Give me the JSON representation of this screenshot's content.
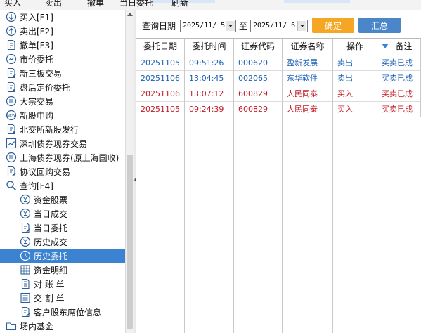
{
  "toolbar": {
    "items": [
      "买入",
      "卖出",
      "撤单",
      "当日委托",
      "刷新"
    ]
  },
  "sidebar": {
    "items": [
      {
        "label": "买入[F1]",
        "icon": "arrow-down-circle-icon",
        "sub": false,
        "selected": false
      },
      {
        "label": "卖出[F2]",
        "icon": "arrow-up-circle-icon",
        "sub": false,
        "selected": false
      },
      {
        "label": "撤单[F3]",
        "icon": "cancel-order-icon",
        "sub": false,
        "selected": false
      },
      {
        "label": "市价委托",
        "icon": "market-order-icon",
        "sub": false,
        "selected": false
      },
      {
        "label": "新三板交易",
        "icon": "document-edit-icon",
        "sub": false,
        "selected": false
      },
      {
        "label": "盘后定价委托",
        "icon": "document-edit-icon",
        "sub": false,
        "selected": false
      },
      {
        "label": "大宗交易",
        "icon": "list-circle-icon",
        "sub": false,
        "selected": false
      },
      {
        "label": "新股申购",
        "icon": "new-badge-icon",
        "sub": false,
        "selected": false
      },
      {
        "label": "北交所新股发行",
        "icon": "document-edit-icon",
        "sub": false,
        "selected": false
      },
      {
        "label": "深圳债券现券交易",
        "icon": "chart-icon",
        "sub": false,
        "selected": false
      },
      {
        "label": "上海债券现券(原上海国收)",
        "icon": "list-circle-icon",
        "sub": false,
        "selected": false
      },
      {
        "label": "协议回购交易",
        "icon": "document-edit-icon",
        "sub": false,
        "selected": false
      },
      {
        "label": "查询[F4]",
        "icon": "search-icon",
        "sub": false,
        "selected": false
      },
      {
        "label": "资金股票",
        "icon": "yuan-circle-icon",
        "sub": true,
        "selected": false
      },
      {
        "label": "当日成交",
        "icon": "yuan-circle-icon",
        "sub": true,
        "selected": false
      },
      {
        "label": "当日委托",
        "icon": "document-edit-icon",
        "sub": true,
        "selected": false
      },
      {
        "label": "历史成交",
        "icon": "yuan-circle-icon",
        "sub": true,
        "selected": false
      },
      {
        "label": "历史委托",
        "icon": "history-icon",
        "sub": true,
        "selected": true
      },
      {
        "label": "资金明细",
        "icon": "grid-doc-icon",
        "sub": true,
        "selected": false
      },
      {
        "label": "对 账 单",
        "icon": "statement-icon",
        "sub": true,
        "selected": false
      },
      {
        "label": "交 割 单",
        "icon": "list-doc-icon",
        "sub": true,
        "selected": false
      },
      {
        "label": "客户股东席位信息",
        "icon": "document-edit-icon",
        "sub": true,
        "selected": false
      },
      {
        "label": "场内基金",
        "icon": "folder-icon",
        "sub": false,
        "selected": false
      }
    ]
  },
  "query": {
    "label": "查询日期",
    "start_date": "2025/11/ 5",
    "to_label": "至",
    "end_date": "2025/11/ 6",
    "confirm_label": "确定",
    "summary_label": "汇总"
  },
  "table": {
    "columns": [
      "委托日期",
      "委托时间",
      "证券代码",
      "证券名称",
      "操作",
      "备注"
    ],
    "rows": [
      {
        "cells": [
          "20251105",
          "09:51:26",
          "000620",
          "盈新发展",
          "卖出",
          "买卖已成"
        ],
        "color": "#1a5fb4"
      },
      {
        "cells": [
          "20251106",
          "13:04:45",
          "002065",
          "东华软件",
          "卖出",
          "买卖已成"
        ],
        "color": "#1a5fb4"
      },
      {
        "cells": [
          "20251106",
          "13:07:12",
          "600829",
          "人民同泰",
          "买入",
          "买卖已成"
        ],
        "color": "#c01c28"
      },
      {
        "cells": [
          "20251105",
          "09:24:39",
          "600829",
          "人民同泰",
          "买入",
          "买卖已成"
        ],
        "color": "#c01c28"
      }
    ]
  },
  "colors": {
    "selected": "#3b82d1",
    "confirm": "#f5a623",
    "summary": "#4a86c8",
    "sell": "#1a5fb4",
    "buy": "#c01c28"
  }
}
